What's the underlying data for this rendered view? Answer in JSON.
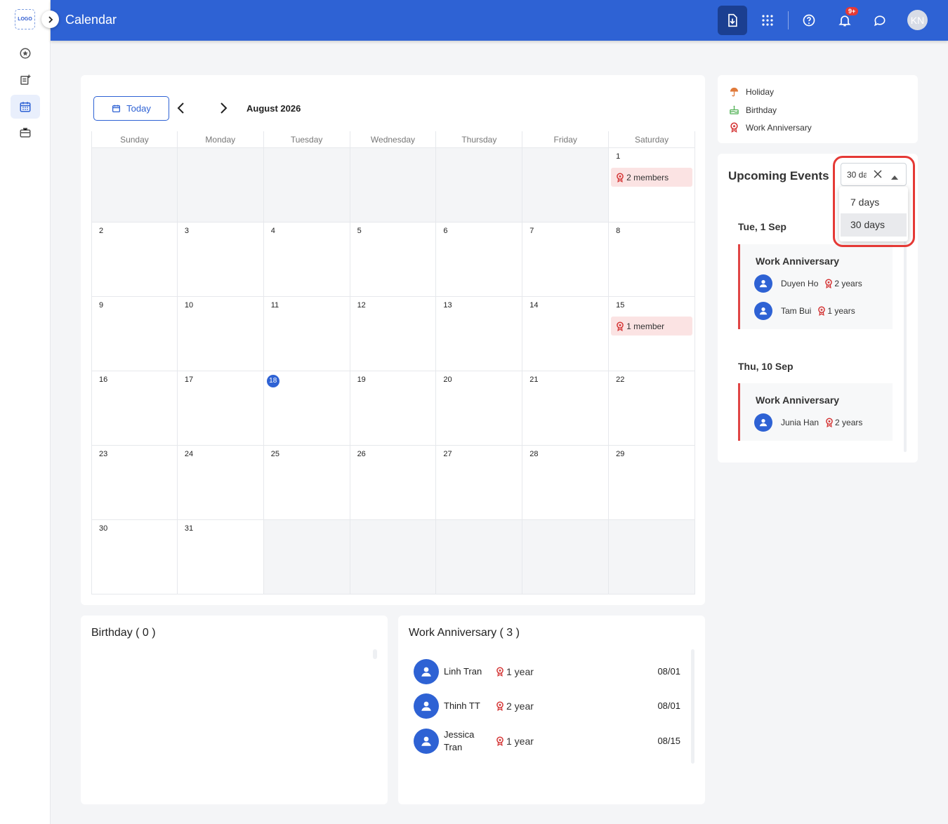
{
  "rail": {
    "logo": "LOGO",
    "items": [
      {
        "icon": "star-circle-icon"
      },
      {
        "icon": "note-add-icon"
      },
      {
        "icon": "calendar-icon",
        "active": true
      },
      {
        "icon": "briefcase-icon"
      }
    ]
  },
  "header": {
    "title": "Calendar",
    "notif_count": "9+",
    "avatar_initials": "KN"
  },
  "calendar": {
    "today_label": "Today",
    "month_label": "August 2026",
    "weekdays": [
      "Sunday",
      "Monday",
      "Tuesday",
      "Wednesday",
      "Thursday",
      "Friday",
      "Saturday"
    ],
    "today_date": "18",
    "days": [
      {
        "d": "",
        "off": true
      },
      {
        "d": "",
        "off": true
      },
      {
        "d": "",
        "off": true
      },
      {
        "d": "",
        "off": true
      },
      {
        "d": "",
        "off": true
      },
      {
        "d": "",
        "off": true
      },
      {
        "d": "1",
        "event": "2 members"
      },
      {
        "d": "2"
      },
      {
        "d": "3"
      },
      {
        "d": "4"
      },
      {
        "d": "5"
      },
      {
        "d": "6"
      },
      {
        "d": "7"
      },
      {
        "d": "8"
      },
      {
        "d": "9"
      },
      {
        "d": "10"
      },
      {
        "d": "11"
      },
      {
        "d": "12"
      },
      {
        "d": "13"
      },
      {
        "d": "14"
      },
      {
        "d": "15",
        "event": "1 member"
      },
      {
        "d": "16"
      },
      {
        "d": "17"
      },
      {
        "d": "18"
      },
      {
        "d": "19"
      },
      {
        "d": "20"
      },
      {
        "d": "21"
      },
      {
        "d": "22"
      },
      {
        "d": "23"
      },
      {
        "d": "24"
      },
      {
        "d": "25"
      },
      {
        "d": "26"
      },
      {
        "d": "27"
      },
      {
        "d": "28"
      },
      {
        "d": "29"
      },
      {
        "d": "30"
      },
      {
        "d": "31"
      },
      {
        "d": "",
        "off": true
      },
      {
        "d": "",
        "off": true
      },
      {
        "d": "",
        "off": true
      },
      {
        "d": "",
        "off": true
      },
      {
        "d": "",
        "off": true
      }
    ]
  },
  "legend": {
    "holiday": "Holiday",
    "birthday": "Birthday",
    "anniversary": "Work Anniversary"
  },
  "upcoming": {
    "title": "Upcoming Events",
    "filter": {
      "value": "30 days",
      "options": [
        "7 days",
        "30 days"
      ]
    },
    "groups": [
      {
        "date": "Tue, 1 Sep",
        "event_title": "Work Anniversary",
        "people": [
          {
            "name": "Duyen Ho",
            "years": "2 years"
          },
          {
            "name": "Tam Bui",
            "years": "1 years"
          }
        ]
      },
      {
        "date": "Thu, 10 Sep",
        "event_title": "Work Anniversary",
        "people": [
          {
            "name": "Junia Han",
            "years": "2 years"
          }
        ]
      }
    ]
  },
  "birthday_panel": {
    "title": "Birthday ( 0 )"
  },
  "anniversary_panel": {
    "title": "Work Anniversary ( 3 )",
    "rows": [
      {
        "name": "Linh Tran",
        "years": "1 year",
        "date": "08/01"
      },
      {
        "name": "Thinh TT",
        "years": "2 year",
        "date": "08/01"
      },
      {
        "name": "Jessica Tran",
        "years": "1 year",
        "date": "08/15"
      }
    ]
  },
  "colors": {
    "primary": "#2e62d4",
    "anniversary": "#d32f2f",
    "holiday": "#e07a3a",
    "birthday": "#4caf50"
  }
}
